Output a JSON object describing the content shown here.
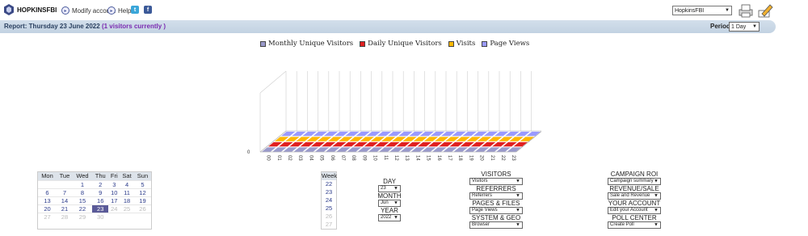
{
  "header": {
    "brand": "HOPKINSFBI",
    "modify_account": "Modify account",
    "help": "Help",
    "site_select": "HopkinsFBI"
  },
  "report": {
    "title": "Report: Thursday 23 June 2022",
    "visitors_currently": "(1 visitors currently )",
    "period_label": "Period",
    "period_value": "1 Day"
  },
  "colors": {
    "monthly_unique": "#9a9acb",
    "daily_unique": "#e02020",
    "visits": "#ffb800",
    "page_views": "#9a9aff"
  },
  "chart_data": {
    "type": "bar",
    "legend": [
      "Monthly Unique Visitors",
      "Daily Unique Visitors",
      "Visits",
      "Page Views"
    ],
    "categories": [
      "00",
      "01",
      "02",
      "03",
      "04",
      "05",
      "06",
      "07",
      "08",
      "09",
      "10",
      "11",
      "12",
      "13",
      "14",
      "15",
      "16",
      "17",
      "18",
      "19",
      "20",
      "21",
      "22",
      "23"
    ],
    "series": [
      {
        "name": "Monthly Unique Visitors",
        "values": [
          0,
          0,
          0,
          0,
          0,
          0,
          0,
          0,
          0,
          0,
          0,
          0,
          0,
          0,
          0,
          0,
          0,
          0,
          0,
          0,
          0,
          0,
          0,
          0
        ]
      },
      {
        "name": "Daily Unique Visitors",
        "values": [
          0,
          0,
          0,
          0,
          0,
          0,
          0,
          0,
          0,
          0,
          0,
          0,
          0,
          0,
          0,
          0,
          0,
          0,
          0,
          0,
          0,
          0,
          0,
          0
        ]
      },
      {
        "name": "Visits",
        "values": [
          0,
          0,
          0,
          0,
          0,
          0,
          0,
          0,
          0,
          0,
          0,
          0,
          0,
          0,
          0,
          0,
          0,
          0,
          0,
          0,
          0,
          0,
          0,
          0
        ]
      },
      {
        "name": "Page Views",
        "values": [
          0,
          0,
          0,
          0,
          0,
          0,
          0,
          0,
          0,
          0,
          0,
          0,
          0,
          0,
          0,
          0,
          0,
          0,
          0,
          0,
          0,
          0,
          0,
          0
        ]
      }
    ],
    "y_tick_label": "0",
    "grid": true
  },
  "calendar": {
    "headers": [
      "Mon",
      "Tue",
      "Wed",
      "Thu",
      "Fri",
      "Sat",
      "Sun"
    ],
    "rows": [
      [
        "",
        "",
        "1",
        "2",
        "3",
        "4",
        "5"
      ],
      [
        "6",
        "7",
        "8",
        "9",
        "10",
        "11",
        "12"
      ],
      [
        "13",
        "14",
        "15",
        "16",
        "17",
        "18",
        "19"
      ],
      [
        "20",
        "21",
        "22",
        "23",
        "24",
        "25",
        "26"
      ],
      [
        "27",
        "28",
        "29",
        "30",
        "",
        "",
        ""
      ]
    ],
    "today": "23",
    "week_header": "Week",
    "weeks": [
      "22",
      "23",
      "24",
      "25",
      "26",
      "27"
    ]
  },
  "date_select": {
    "day_label": "DAY",
    "day_value": "23",
    "month_label": "MONTH",
    "month_value": "Jun",
    "year_label": "YEAR",
    "year_value": "2022"
  },
  "menus_mid": [
    {
      "label": "VISITORS",
      "value": "Visitors"
    },
    {
      "label": "REFERRERS",
      "value": "Referrers"
    },
    {
      "label": "PAGES & FILES",
      "value": "Page Views"
    },
    {
      "label": "SYSTEM & GEO",
      "value": "Browser"
    }
  ],
  "menus_right": [
    {
      "label": "CAMPAIGN ROI",
      "value": "Campaign summary"
    },
    {
      "label": "REVENUE/SALE",
      "value": "Sale and Revenue"
    },
    {
      "label": "YOUR ACCOUNT",
      "value": "Edit your Account"
    },
    {
      "label": "POLL CENTER",
      "value": "Create Poll"
    }
  ]
}
